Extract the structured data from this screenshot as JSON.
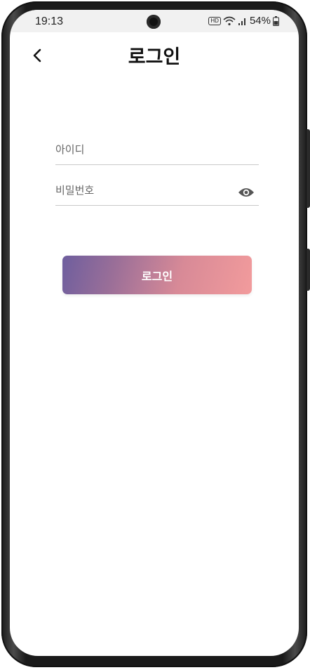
{
  "status_bar": {
    "time": "19:13",
    "hd": "HD",
    "battery": "54%"
  },
  "header": {
    "title": "로그인",
    "back_icon": "chevron-left-icon"
  },
  "form": {
    "id_placeholder": "아이디",
    "id_value": "",
    "password_placeholder": "비밀번호",
    "password_value": "",
    "password_toggle_icon": "eye-icon",
    "login_label": "로그인"
  },
  "colors": {
    "button_gradient_start": "#6e5e9e",
    "button_gradient_end": "#f29b9c",
    "button_text": "#ffffff"
  }
}
